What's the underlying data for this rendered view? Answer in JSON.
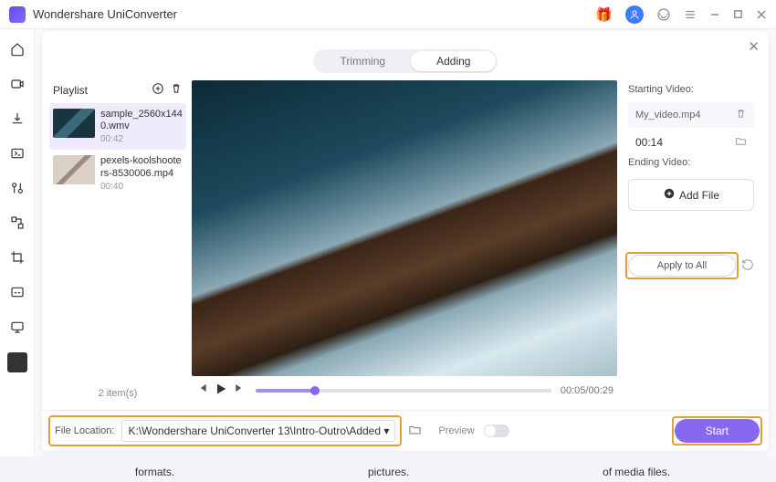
{
  "app_title": "Wondershare UniConverter",
  "tabs": {
    "trimming": "Trimming",
    "adding": "Adding"
  },
  "playlist": {
    "title": "Playlist",
    "items": [
      {
        "name": "sample_2560x1440.wmv",
        "duration": "00:42"
      },
      {
        "name": "pexels-koolshooters-8530006.mp4",
        "duration": "00:40"
      }
    ],
    "count_label": "2 item(s)"
  },
  "player": {
    "time": "00:05/00:29"
  },
  "side": {
    "starting_label": "Starting Video:",
    "starting_file": "My_video.mp4",
    "starting_dur": "00:14",
    "ending_label": "Ending Video:",
    "add_file_label": "Add File",
    "apply_label": "Apply to All"
  },
  "footer": {
    "location_label": "File Location:",
    "location_path": "K:\\Wondershare UniConverter 13\\Intro-Outro\\Added",
    "preview_label": "Preview",
    "start_label": "Start"
  },
  "strip": {
    "a": "formats.",
    "b": "pictures.",
    "c": "of media files."
  }
}
